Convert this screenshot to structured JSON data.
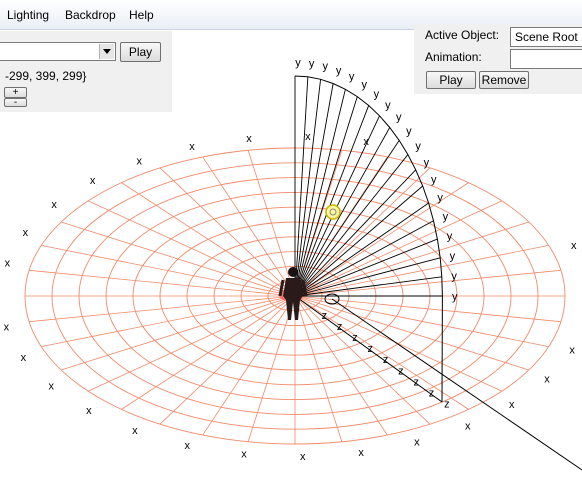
{
  "menu": [
    "Lighting",
    "Backdrop",
    "Help"
  ],
  "left_panel": {
    "play_label": "Play",
    "value_text": "-299, 399, 299}",
    "plus_label": "+",
    "minus_label": "-"
  },
  "right_panel": {
    "active_object_label": "Active Object:",
    "active_object_value": "Scene Root",
    "animation_label": "Animation:",
    "animation_value": "",
    "play_label": "Play",
    "remove_label": "Remove"
  },
  "axis_labels": {
    "x": "x",
    "y": "y",
    "z": "z"
  },
  "colors": {
    "grid": "#f08a6a",
    "lines": "#000000",
    "marker": "#e8d800"
  }
}
